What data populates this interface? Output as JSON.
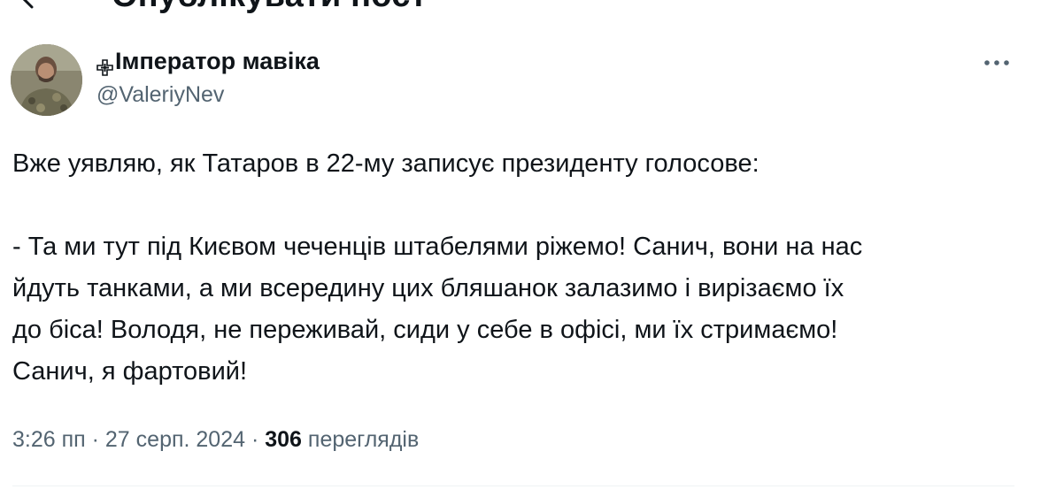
{
  "header": {
    "title": "Опублікувати пост",
    "back_icon": "arrow-left-icon"
  },
  "author": {
    "display_name": "Імператор мавіка",
    "name_prefix_icon": "cross-icon",
    "handle": "@ValeriyNev",
    "avatar_icon": "avatar-photo"
  },
  "more_icon": "more-horizontal-icon",
  "tweet": {
    "lines": [
      "Вже уявляю, як Татаров в 22-му записує президенту голосове:",
      "",
      "- Та ми тут під Києвом чеченців штабелями ріжемо! Санич, вони на нас",
      "йдуть танками, а ми всередину цих бляшанок залазимо і вирізаємо їх",
      "до біса! Володя, не переживай, сиди у себе в офісі, ми їх стримаємо!",
      "Санич, я фартовий!"
    ]
  },
  "meta": {
    "time": "3:26 пп",
    "separator": " · ",
    "date": "27 серп. 2024",
    "views_count": "306",
    "views_label": "переглядів"
  },
  "colors": {
    "text": "#0f1419",
    "secondary": "#536471",
    "divider": "#eff3f4"
  }
}
